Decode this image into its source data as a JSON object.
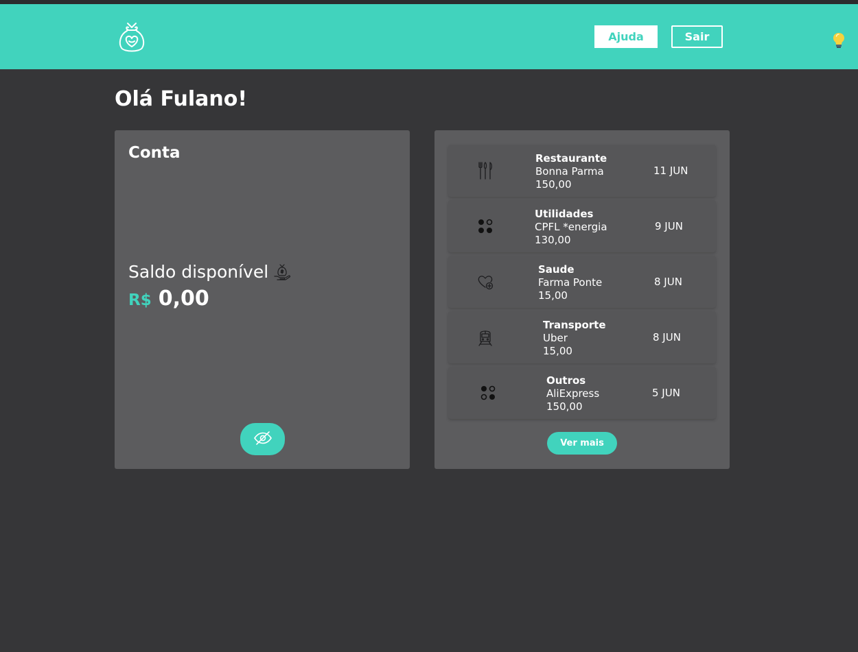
{
  "header": {
    "logo_icon": "money-bag-heart-icon",
    "help_label": "Ajuda",
    "logout_label": "Sair",
    "theme_icon": "lightbulb-icon",
    "accent_color": "#41d3bd"
  },
  "greeting": "Olá Fulano!",
  "account": {
    "title": "Conta",
    "balance_label": "Saldo disponível",
    "balance_icon": "money-bag-hand-icon",
    "currency": "R$",
    "balance": "0,00",
    "toggle_icon": "eye-slash-icon"
  },
  "transactions": {
    "items": [
      {
        "category": "Restaurante",
        "merchant": "Bonna Parma",
        "amount": "150,00",
        "date": "11 JUN",
        "icon": "cutlery-icon"
      },
      {
        "category": "Utilidades",
        "merchant": "CPFL *energia",
        "amount": "130,00",
        "date": "9 JUN",
        "icon": "dots-grid-icon"
      },
      {
        "category": "Saude",
        "merchant": "Farma Ponte",
        "amount": "15,00",
        "date": "8 JUN",
        "icon": "heart-plus-icon"
      },
      {
        "category": "Transporte",
        "merchant": "Uber",
        "amount": "15,00",
        "date": "8 JUN",
        "icon": "train-icon"
      },
      {
        "category": "Outros",
        "merchant": "AliExpress",
        "amount": "150,00",
        "date": "5 JUN",
        "icon": "dots-grid-alt-icon"
      }
    ],
    "more_label": "Ver mais"
  }
}
